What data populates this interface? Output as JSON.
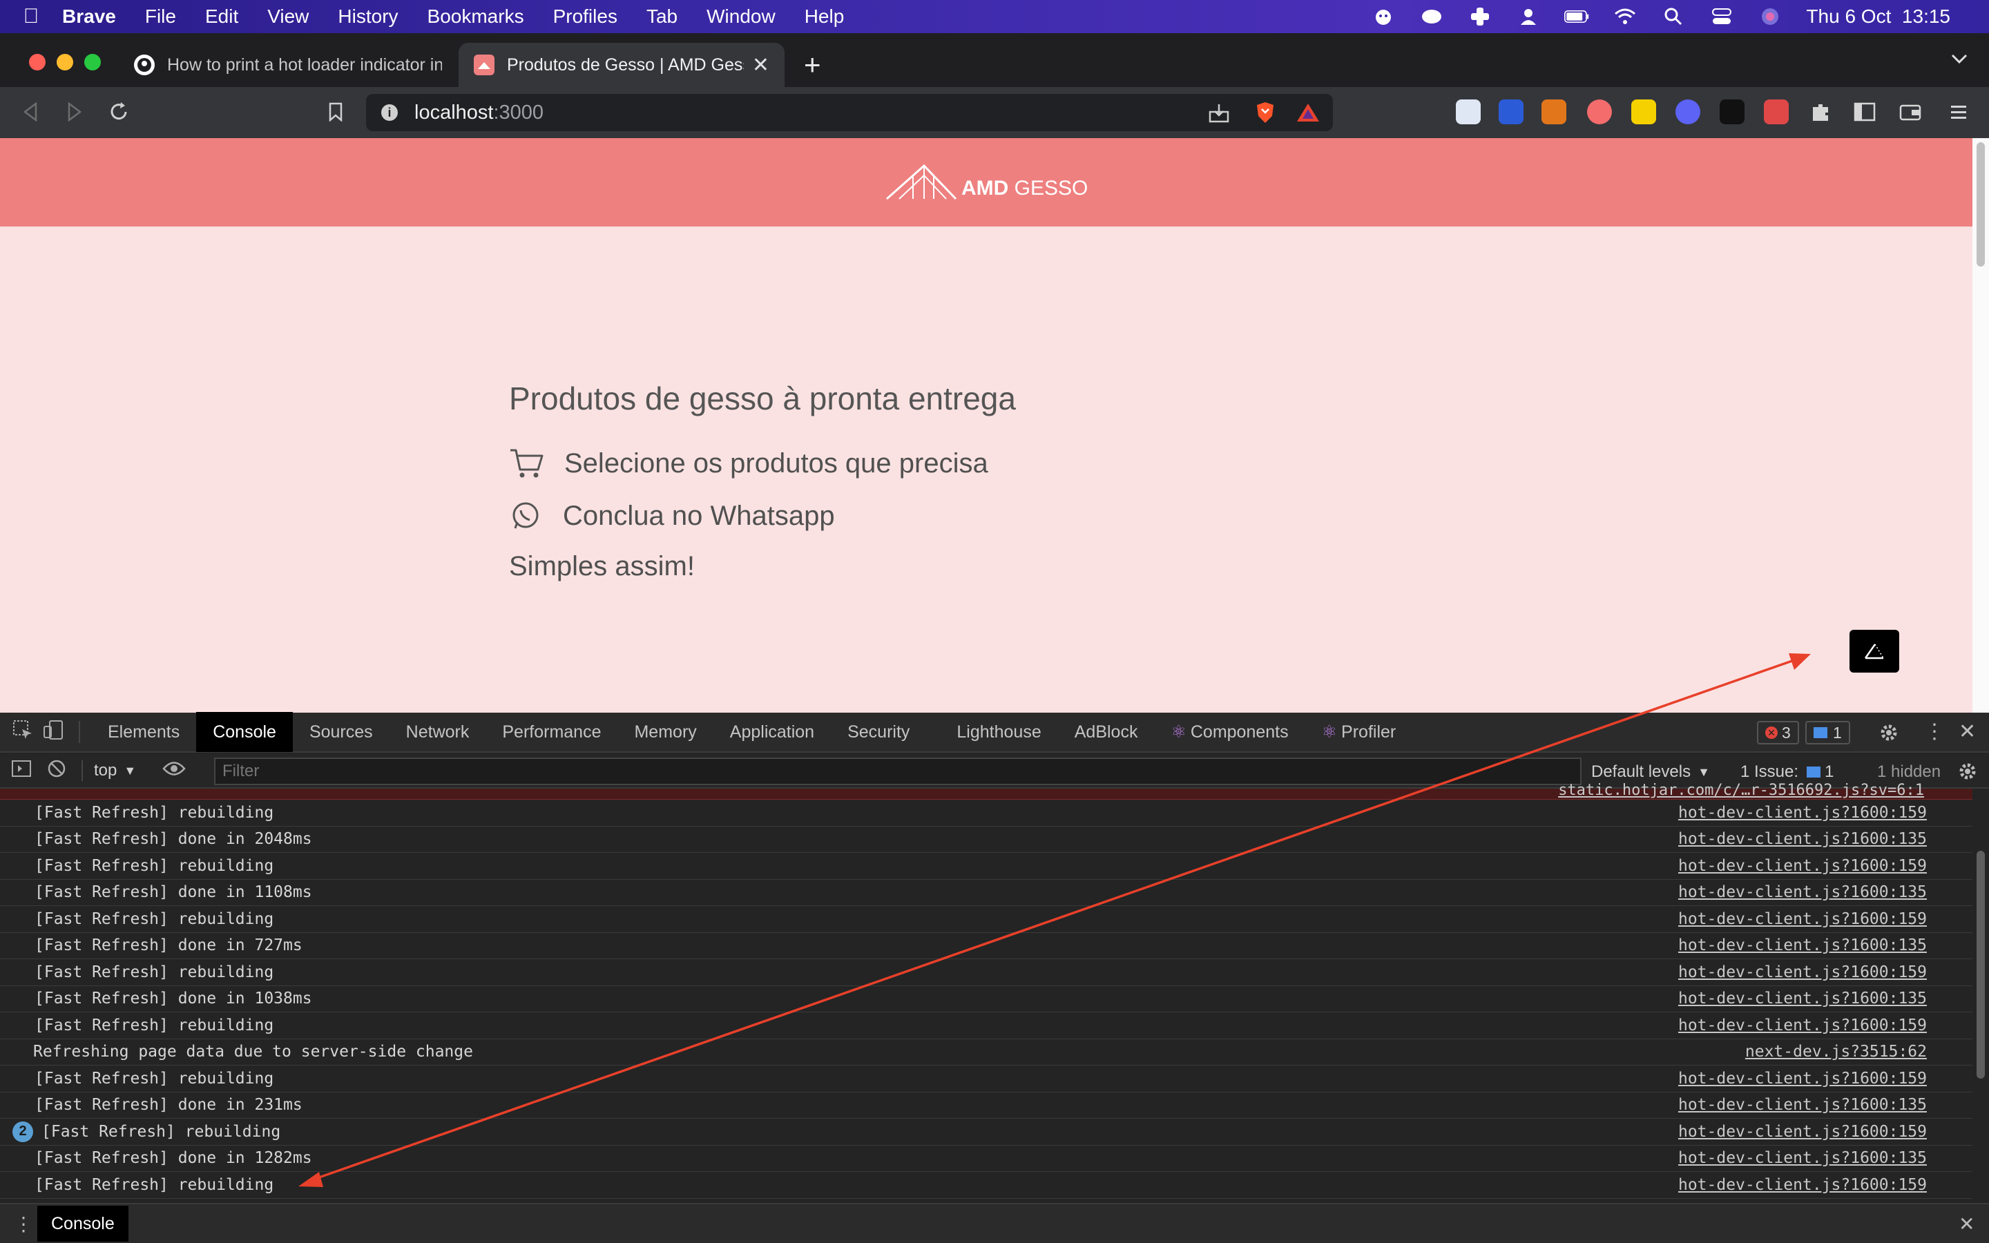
{
  "menubar": {
    "app": "Brave",
    "items": [
      "File",
      "Edit",
      "View",
      "History",
      "Bookmarks",
      "Profiles",
      "Tab",
      "Window",
      "Help"
    ],
    "datetime": "Thu 6 Oct  13:15"
  },
  "browser": {
    "tabs": [
      {
        "title": "How to print a hot loader indicator in"
      },
      {
        "title": "Produtos de Gesso | AMD Gesso"
      }
    ],
    "url_host": "localhost",
    "url_port": ":3000"
  },
  "site": {
    "logo_bold": "AMD",
    "logo_rest": " GESSO",
    "hero_title": "Produtos de gesso à pronta entrega",
    "step1": "Selecione os produtos que precisa",
    "step2": "Conclua no Whatsapp",
    "tagline": "Simples assim!"
  },
  "devtools": {
    "tabs": [
      "Elements",
      "Console",
      "Sources",
      "Network",
      "Performance",
      "Memory",
      "Application",
      "Security",
      "Lighthouse",
      "AdBlock",
      "Components",
      "Profiler"
    ],
    "active_tab": "Console",
    "error_count": "3",
    "message_count": "1",
    "context": "top",
    "filter_placeholder": "Filter",
    "levels": "Default levels",
    "issues_label": "1 Issue:",
    "issues_count": "1",
    "hidden": "1 hidden",
    "truncated_source": "static.hotjar.com/c/…r-3516692.js?sv=6:1",
    "drawer_tab": "Console",
    "console_rows": [
      {
        "msg": "[Fast Refresh] rebuilding",
        "src": "hot-dev-client.js?1600:159"
      },
      {
        "msg": "[Fast Refresh] done in 2048ms",
        "src": "hot-dev-client.js?1600:135"
      },
      {
        "msg": "[Fast Refresh] rebuilding",
        "src": "hot-dev-client.js?1600:159"
      },
      {
        "msg": "[Fast Refresh] done in 1108ms",
        "src": "hot-dev-client.js?1600:135"
      },
      {
        "msg": "[Fast Refresh] rebuilding",
        "src": "hot-dev-client.js?1600:159"
      },
      {
        "msg": "[Fast Refresh] done in 727ms",
        "src": "hot-dev-client.js?1600:135"
      },
      {
        "msg": "[Fast Refresh] rebuilding",
        "src": "hot-dev-client.js?1600:159"
      },
      {
        "msg": "[Fast Refresh] done in 1038ms",
        "src": "hot-dev-client.js?1600:135"
      },
      {
        "msg": "[Fast Refresh] rebuilding",
        "src": "hot-dev-client.js?1600:159"
      },
      {
        "msg": "Refreshing page data due to server-side change",
        "src": "next-dev.js?3515:62"
      },
      {
        "msg": "[Fast Refresh] rebuilding",
        "src": "hot-dev-client.js?1600:159"
      },
      {
        "msg": "[Fast Refresh] done in 231ms",
        "src": "hot-dev-client.js?1600:135"
      },
      {
        "msg": "[Fast Refresh] rebuilding",
        "src": "hot-dev-client.js?1600:159",
        "repeat": "2"
      },
      {
        "msg": "[Fast Refresh] done in 1282ms",
        "src": "hot-dev-client.js?1600:135"
      },
      {
        "msg": "[Fast Refresh] rebuilding",
        "src": "hot-dev-client.js?1600:159"
      }
    ]
  },
  "colors": {
    "site_header": "#ee8080",
    "site_bg": "#fbe2e2",
    "annotation_arrow": "#e8402a",
    "brave_orange": "#fb542b"
  }
}
